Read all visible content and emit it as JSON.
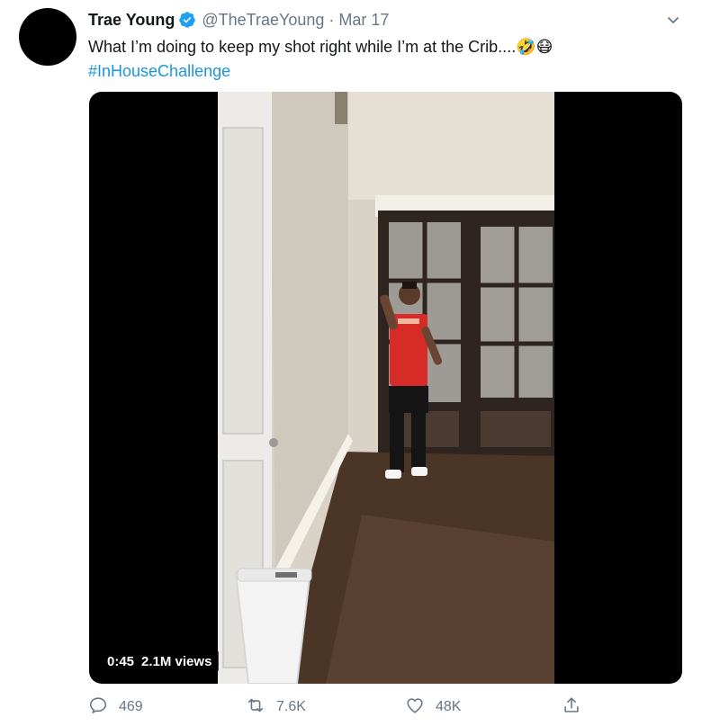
{
  "tweet": {
    "display_name": "Trae Young",
    "verified": true,
    "handle": "@TheTraeYoung",
    "separator": "·",
    "date": "Mar 17",
    "text_line1": "What I’m doing to keep my shot right while I’m at the Crib....",
    "emoji_1": "🤣",
    "emoji_2": "😷",
    "hashtag": "#InHouseChallenge"
  },
  "media": {
    "type": "video",
    "duration": "0:45",
    "views": "2.1M views"
  },
  "actions": {
    "reply_count": "469",
    "retweet_count": "7.6K",
    "like_count": "48K",
    "icons": [
      "reply-icon",
      "retweet-icon",
      "like-icon",
      "share-icon"
    ]
  },
  "colors": {
    "link": "#1b95e0",
    "verified_badge": "#1da1f2",
    "secondary_text": "#657786",
    "jersey": "#d62b27"
  }
}
